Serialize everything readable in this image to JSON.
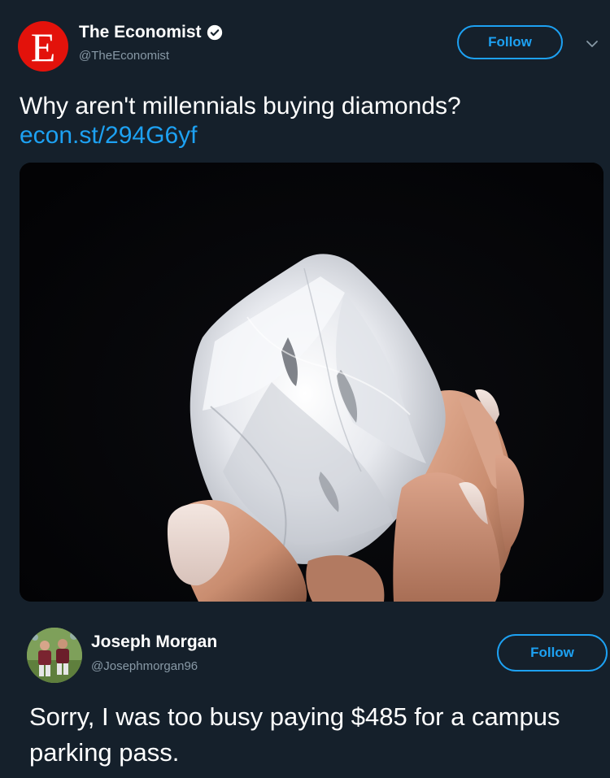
{
  "tweet": {
    "avatar_letter": "E",
    "display_name": "The Economist",
    "verified": true,
    "handle": "@TheEconomist",
    "follow_label": "Follow",
    "text": "Why aren't millennials buying diamonds?",
    "link": "econ.st/294G6yf",
    "media_description_icon": "photo-of-rough-diamond"
  },
  "reply": {
    "display_name": "Joseph Morgan",
    "handle": "@Josephmorgan96",
    "follow_label": "Follow",
    "text": "Sorry, I was too busy paying $485 for a campus parking pass."
  },
  "colors": {
    "background": "#15202b",
    "accent": "#1da1f2",
    "muted": "#8899a6",
    "economist_red": "#e3120b"
  }
}
